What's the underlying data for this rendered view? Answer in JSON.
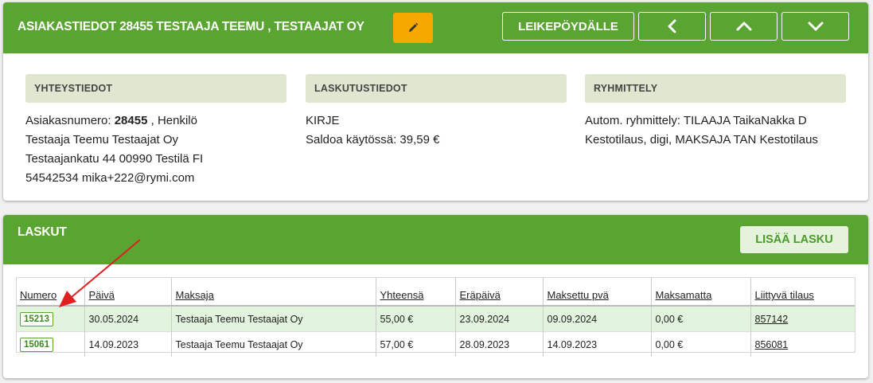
{
  "header": {
    "title": "ASIAKASTIEDOT 28455 TESTAAJA TEEMU , TESTAAJAT OY",
    "edit_icon": "pencil-icon",
    "copy_label": "LEIKEPÖYDÄLLE",
    "prev_icon": "chevron-left-icon",
    "up_icon": "chevron-up-icon",
    "down_icon": "chevron-down-icon"
  },
  "contact": {
    "heading": "YHTEYSTIEDOT",
    "number_label": "Asiakasnumero: ",
    "number": "28455",
    "type": " , Henkilö",
    "name": "Testaaja Teemu Testaajat Oy",
    "address": "Testaajankatu 44 00990 Testilä FI",
    "phone_email": "54542534 mika+222@rymi.com"
  },
  "billing": {
    "heading": "LASKUTUSTIEDOT",
    "method": "KIRJE",
    "balance": "Saldoa käytössä: 39,59 €"
  },
  "grouping": {
    "heading": "RYHMITTELY",
    "line1": "Autom. ryhmittely: TILAAJA TaikaNakka D",
    "line2": "Kestotilaus, digi, MAKSAJA TAN Kestotilaus"
  },
  "invoices": {
    "title": "LASKUT",
    "add_label": "LISÄÄ LASKU",
    "columns": [
      "Numero",
      "Päivä",
      "Maksaja",
      "Yhteensä",
      "Eräpäivä",
      "Maksettu pvä",
      "Maksamatta",
      "Liittyvä tilaus"
    ],
    "rows": [
      [
        "15213",
        "30.05.2024",
        "Testaaja Teemu Testaajat Oy",
        "55,00 €",
        "23.09.2024",
        "09.09.2024",
        "0,00 €",
        "857142"
      ],
      [
        "15061",
        "14.09.2023",
        "Testaaja Teemu Testaajat Oy",
        "57,00 €",
        "28.09.2023",
        "14.09.2023",
        "0,00 €",
        "856081"
      ]
    ]
  },
  "colors": {
    "header_green": "#5aa532",
    "edit_orange": "#f6a800",
    "section_bg": "#dfe7d0",
    "selected_row": "#e2f4de",
    "arrow_red": "#e02020"
  }
}
